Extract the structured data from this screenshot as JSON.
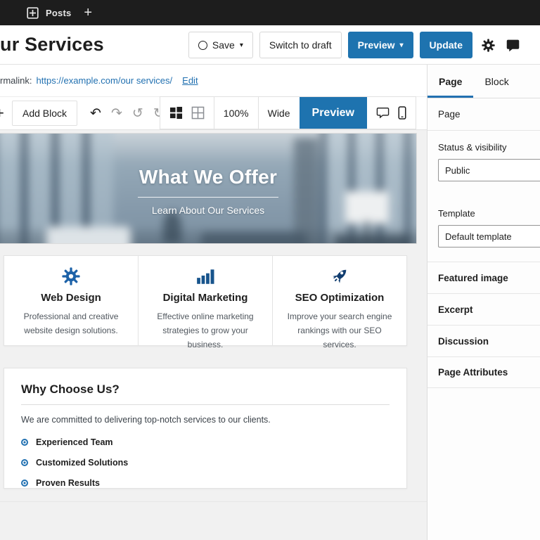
{
  "topbar": {
    "posts_label": "Posts",
    "plus_label": "+"
  },
  "header": {
    "title": "ur Services",
    "save_label": "Save",
    "switch_to_draft_label": "Switch to draft",
    "preview_label": "Preview",
    "update_label": "Update"
  },
  "permalink": {
    "label": "rmalink:",
    "url": "https://example.com/our services/",
    "edit_label": "Edit"
  },
  "toolbar": {
    "add_block_label": "Add Block",
    "zoom_level": "100%",
    "width_label": "Wide",
    "preview_label": "Preview"
  },
  "hero": {
    "title": "What We Offer",
    "subtitle": "Learn About Our Services"
  },
  "services": [
    {
      "icon": "gear-icon",
      "title": "Web Design",
      "description": "Professional and creative website design solutions."
    },
    {
      "icon": "bar-chart-icon",
      "title": "Digital Marketing",
      "description": "Effective online marketing strategies to grow your business."
    },
    {
      "icon": "rocket-icon",
      "title": "SEO Optimization",
      "description": "Improve your search engine rankings with our SEO services."
    }
  ],
  "why": {
    "title": "Why Choose Us?",
    "paragraph": "We are committed to delivering top-notch services to our clients.",
    "items": [
      "Experienced Team",
      "Customized Solutions",
      "Proven Results"
    ]
  },
  "sidebar": {
    "tabs": [
      "Page",
      "Block"
    ],
    "panel_label": "Page",
    "status_label": "Status & visibility",
    "status_value": "Public",
    "template_label": "Template",
    "template_value": "Default template",
    "panels": [
      "Featured image",
      "Excerpt",
      "Discussion",
      "Page Attributes"
    ]
  },
  "colors": {
    "accent_blue": "#1e73af",
    "link_blue": "#2271b1",
    "topbar_dark": "#1d1d1d",
    "gear_icon_blue": "#1d62a8",
    "chart_icon_blue": "#17548c",
    "rocket_icon_blue": "#123e70"
  }
}
